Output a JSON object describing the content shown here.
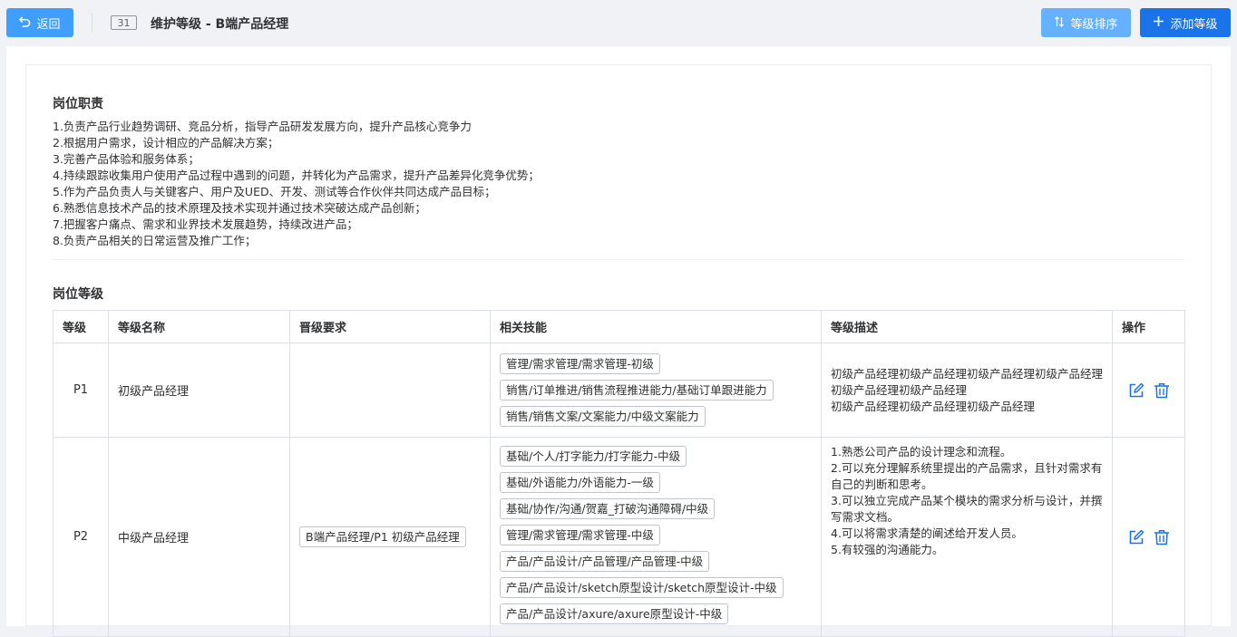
{
  "header": {
    "back_label": "返回",
    "code": "31",
    "title": "维护等级 - B端产品经理",
    "sort_label": "等级排序",
    "add_label": "添加等级"
  },
  "duties": {
    "title": "岗位职责",
    "items": [
      "1.负责产品行业趋势调研、竞品分析，指导产品研发发展方向，提升产品核心竞争力",
      "2.根据用户需求，设计相应的产品解决方案；",
      "3.完善产品体验和服务体系；",
      "4.持续跟踪收集用户使用产品过程中遇到的问题，并转化为产品需求，提升产品差异化竞争优势；",
      "5.作为产品负责人与关键客户、用户及UED、开发、测试等合作伙伴共同达成产品目标；",
      "6.熟悉信息技术产品的技术原理及技术实现并通过技术突破达成产品创新；",
      "7.把握客户痛点、需求和业界技术发展趋势，持续改进产品；",
      "8.负责产品相关的日常运营及推广工作；"
    ]
  },
  "levels": {
    "title": "岗位等级",
    "columns": [
      "等级",
      "等级名称",
      "晋级要求",
      "相关技能",
      "等级描述",
      "操作"
    ],
    "rows": [
      {
        "level": "P1",
        "name": "初级产品经理",
        "requirement": "",
        "skills": [
          "管理/需求管理/需求管理-初级",
          "销售/订单推进/销售流程推进能力/基础订单跟进能力",
          "销售/销售文案/文案能力/中级文案能力"
        ],
        "description": [
          "初级产品经理初级产品经理初级产品经理初级产品经理",
          "初级产品经理初级产品经理",
          "初级产品经理初级产品经理初级产品经理"
        ]
      },
      {
        "level": "P2",
        "name": "中级产品经理",
        "requirement": "B端产品经理/P1 初级产品经理",
        "skills": [
          "基础/个人/打字能力/打字能力-中级",
          "基础/外语能力/外语能力-一级",
          "基础/协作/沟通/贺嘉_打破沟通障碍/中级",
          "管理/需求管理/需求管理-中级",
          "产品/产品设计/产品管理/产品管理-中级",
          "产品/产品设计/sketch原型设计/sketch原型设计-中级",
          "产品/产品设计/axure/axure原型设计-中级"
        ],
        "description": [
          "1.熟悉公司产品的设计理念和流程。",
          "2.可以充分理解系统里提出的产品需求，且针对需求有自己的判断和思考。",
          "3.可以独立完成产品某个模块的需求分析与设计，并撰写需求文档。",
          "4.可以将需求清楚的阐述给开发人员。",
          "5.有较强的沟通能力。"
        ]
      }
    ]
  },
  "colors": {
    "primary": "#409eff",
    "primary_light": "#66b1ff",
    "primary_dark": "#1a73e8",
    "icon": "#1a73e8"
  },
  "icons": {
    "back": "undo-arrow-icon",
    "sort": "sort-icon",
    "add": "plus-icon",
    "edit": "edit-icon",
    "delete": "trash-icon"
  }
}
